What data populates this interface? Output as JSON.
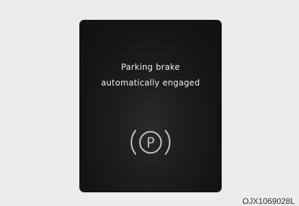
{
  "display": {
    "message_line1": "Parking brake",
    "message_line2": "automatically engaged",
    "icon": "parking-brake-icon",
    "icon_letter": "P"
  },
  "figure_code": "OJX1069028L",
  "colors": {
    "display_background": "#141414",
    "text": "#f0f0f0",
    "icon": "#bdbdbd",
    "page_background": "#ececec"
  }
}
